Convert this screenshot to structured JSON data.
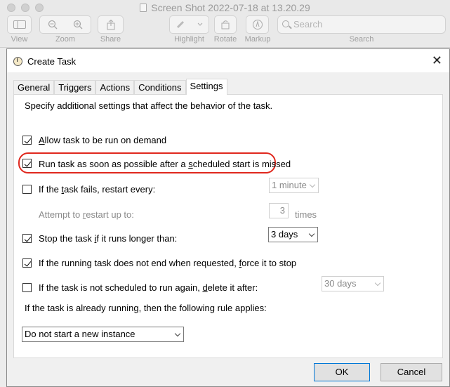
{
  "mac": {
    "title": "Screen Shot 2022-07-18 at 13.20.29",
    "toolbar": {
      "view_label": "View",
      "zoom_label": "Zoom",
      "share_label": "Share",
      "highlight_label": "Highlight",
      "rotate_label": "Rotate",
      "markup_label": "Markup",
      "search_label": "Search",
      "search_placeholder": "Search"
    }
  },
  "dialog": {
    "title": "Create Task",
    "close_glyph": "✕",
    "tabs": [
      "General",
      "Triggers",
      "Actions",
      "Conditions",
      "Settings"
    ],
    "active_tab": "Settings",
    "intro": "Specify additional settings that affect the behavior of the task.",
    "options": {
      "allow_run_on_demand": {
        "pre": "",
        "u": "A",
        "post": "llow task to be run on demand",
        "checked": true
      },
      "run_asap": {
        "pre": "Run task as soon as possible after a ",
        "u": "s",
        "post": "cheduled start is missed",
        "checked": true
      },
      "restart_on_fail": {
        "pre": "If the ",
        "u": "t",
        "post": "ask fails, restart every:",
        "checked": false
      },
      "restart_interval": "1 minute",
      "restart_attempts_label": {
        "pre": "Attempt to ",
        "u": "r",
        "post": "estart up to:"
      },
      "restart_attempts_value": "3",
      "restart_attempts_unit": "times",
      "stop_if_longer": {
        "pre": "Stop the task ",
        "u": "i",
        "post": "f it runs longer than:",
        "checked": true
      },
      "stop_duration": "3 days",
      "force_stop": {
        "pre": "If the running task does not end when requested, ",
        "u": "f",
        "post": "orce it to stop",
        "checked": true
      },
      "delete_after": {
        "pre": "If the task is not scheduled to run again, ",
        "u": "d",
        "post": "elete it after:",
        "checked": false
      },
      "delete_duration": "30 days",
      "running_rule_label": {
        "pre": "If the task is already runnin",
        "u": "g",
        "post": ", then the following rule applies:"
      },
      "running_rule_value": "Do not start a new instance"
    },
    "ok_label": "OK",
    "cancel_label": "Cancel"
  }
}
